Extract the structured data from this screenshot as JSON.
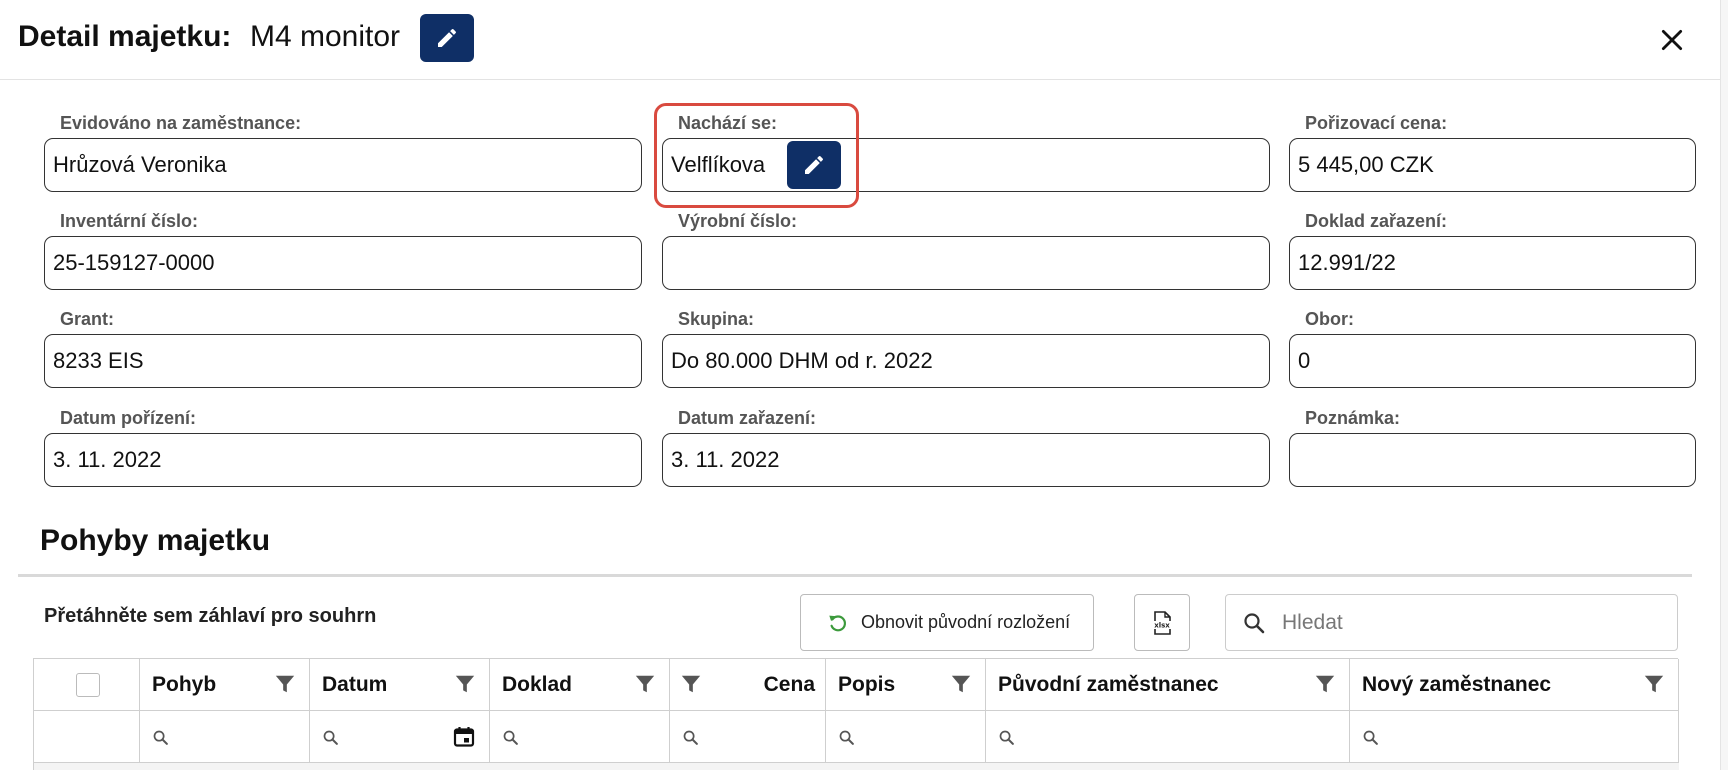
{
  "dialog": {
    "title_label": "Detail majetku:",
    "title_value": "M4 monitor",
    "edit_icon": "pencil-icon",
    "close_icon": "close-icon"
  },
  "fields": [
    {
      "label": "Evidováno na zaměstnance:",
      "value": "Hrůzová Veronika"
    },
    {
      "label": "Nachází se:",
      "value": "Velflíkova"
    },
    {
      "label": "Pořizovací cena:",
      "value": "5 445,00 CZK"
    },
    {
      "label": "Inventární číslo:",
      "value": "25-159127-0000"
    },
    {
      "label": "Výrobní číslo:",
      "value": ""
    },
    {
      "label": "Doklad zařazení:",
      "value": "12.991/22"
    },
    {
      "label": "Grant:",
      "value": "8233 EIS"
    },
    {
      "label": "Skupina:",
      "value": "Do 80.000 DHM od r. 2022"
    },
    {
      "label": "Obor:",
      "value": "0"
    },
    {
      "label": "Datum pořízení:",
      "value": "3. 11. 2022"
    },
    {
      "label": "Datum zařazení:",
      "value": "3. 11. 2022"
    },
    {
      "label": "Poznámka:",
      "value": ""
    }
  ],
  "movements": {
    "title": "Pohyby majetku",
    "group_panel_text": "Přetáhněte sem záhlaví pro souhrn",
    "reset_label": "Obnovit původní rozložení",
    "export_icon": "xlsx-export-icon",
    "search_placeholder": "Hledat",
    "columns": [
      "Pohyb",
      "Datum",
      "Doklad",
      "Cena",
      "Popis",
      "Původní zaměstnanec",
      "Nový zaměstnanec"
    ]
  },
  "colors": {
    "primary": "#0f2f66",
    "highlight": "#d94a3f",
    "reset_icon": "#3c9a3c"
  }
}
